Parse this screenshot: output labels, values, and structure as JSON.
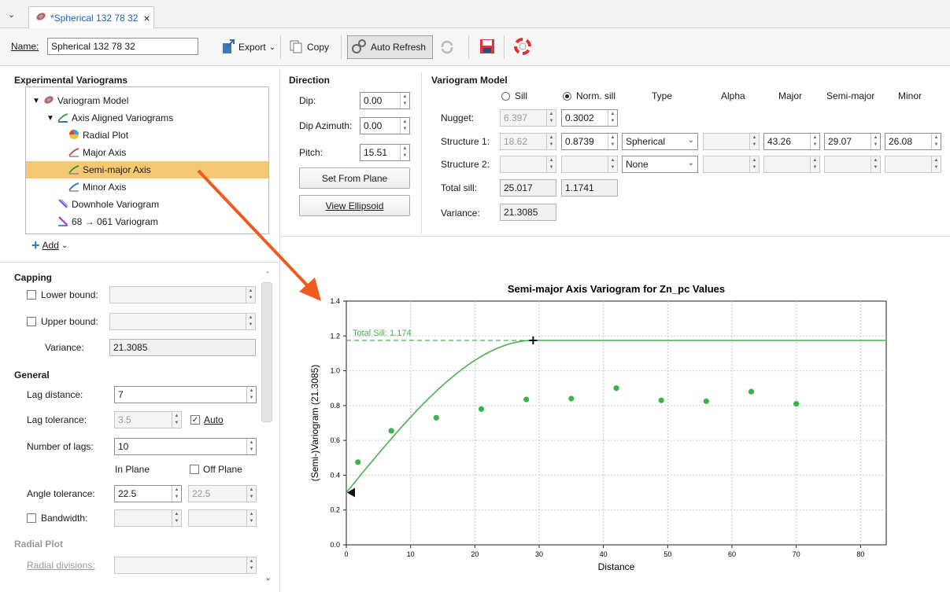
{
  "tab": {
    "title": "*Spherical 132 78 32",
    "close": "×"
  },
  "toolbar": {
    "name_label": "Name:",
    "name_value": "Spherical 132 78 32",
    "export_label": "Export",
    "copy_label": "Copy",
    "auto_refresh_label": "Auto Refresh"
  },
  "left": {
    "tree_title": "Experimental Variograms",
    "tree_items": [
      "Variogram Model",
      "Axis Aligned Variograms",
      "Radial Plot",
      "Major Axis",
      "Semi-major Axis",
      "Minor Axis",
      "Downhole Variogram",
      "68 → 061 Variogram"
    ],
    "add_label": "Add",
    "capping_title": "Capping",
    "lower_bound_label": "Lower bound:",
    "upper_bound_label": "Upper bound:",
    "variance_label": "Variance:",
    "variance_value": "21.3085",
    "general_title": "General",
    "lag_distance_label": "Lag distance:",
    "lag_distance_value": "7",
    "lag_tolerance_label": "Lag tolerance:",
    "lag_tolerance_value": "3.5",
    "auto_label": "Auto",
    "num_lags_label": "Number of lags:",
    "num_lags_value": "10",
    "in_plane_label": "In Plane",
    "off_plane_label": "Off Plane",
    "angle_tol_label": "Angle tolerance:",
    "angle_tol_value": "22.5",
    "angle_tol_value2": "22.5",
    "bandwidth_label": "Bandwidth:",
    "radial_plot_title": "Radial Plot",
    "radial_divisions_label": "Radial divisions:"
  },
  "direction": {
    "title": "Direction",
    "dip_label": "Dip:",
    "dip_value": "0.00",
    "dip_azimuth_label": "Dip Azimuth:",
    "dip_azimuth_value": "0.00",
    "pitch_label": "Pitch:",
    "pitch_value": "15.51",
    "set_from_plane": "Set From Plane",
    "view_ellipsoid": "View Ellipsoid"
  },
  "model": {
    "title": "Variogram Model",
    "sill_label": "Sill",
    "norm_sill_label": "Norm. sill",
    "col_type": "Type",
    "col_alpha": "Alpha",
    "col_major": "Major",
    "col_semimajor": "Semi-major",
    "col_minor": "Minor",
    "nugget_label": "Nugget:",
    "nugget_sill": "6.397",
    "nugget_norm": "0.3002",
    "s1_label": "Structure 1:",
    "s1_sill": "18.62",
    "s1_norm": "0.8739",
    "s1_type": "Spherical",
    "s1_major": "43.26",
    "s1_semimajor": "29.07",
    "s1_minor": "26.08",
    "s2_label": "Structure 2:",
    "s2_type": "None",
    "total_sill_label": "Total sill:",
    "total_sill_value": "25.017",
    "total_sill_norm": "1.1741",
    "variance_label": "Variance:",
    "variance_value": "21.3085"
  },
  "chart_data": {
    "type": "scatter",
    "title": "Semi-major Axis Variogram for Zn_pc Values",
    "xlabel": "Distance",
    "ylabel": "(Semi-)Variogram (21.3085)",
    "xlim": [
      0,
      84
    ],
    "ylim": [
      0,
      1.4
    ],
    "xticks": [
      0,
      10,
      20,
      30,
      40,
      50,
      60,
      70,
      80
    ],
    "yticks": [
      0.0,
      0.2,
      0.4,
      0.6,
      0.8,
      1.0,
      1.2,
      1.4
    ],
    "points": {
      "x": [
        1.8,
        7,
        14,
        21,
        28,
        35,
        42,
        49,
        56,
        63,
        70
      ],
      "y": [
        0.475,
        0.655,
        0.73,
        0.78,
        0.835,
        0.84,
        0.9,
        0.83,
        0.825,
        0.88,
        0.81
      ]
    },
    "model": {
      "nugget": 0.3002,
      "sill": 0.8739,
      "range": 29.07
    },
    "total_sill_label": "Total Sill: 1.174",
    "total_sill": 1.1741,
    "colors": {
      "model": "#4caf50",
      "points": "#3bb34a",
      "arrow": "#f05a1e"
    },
    "grid": true
  }
}
